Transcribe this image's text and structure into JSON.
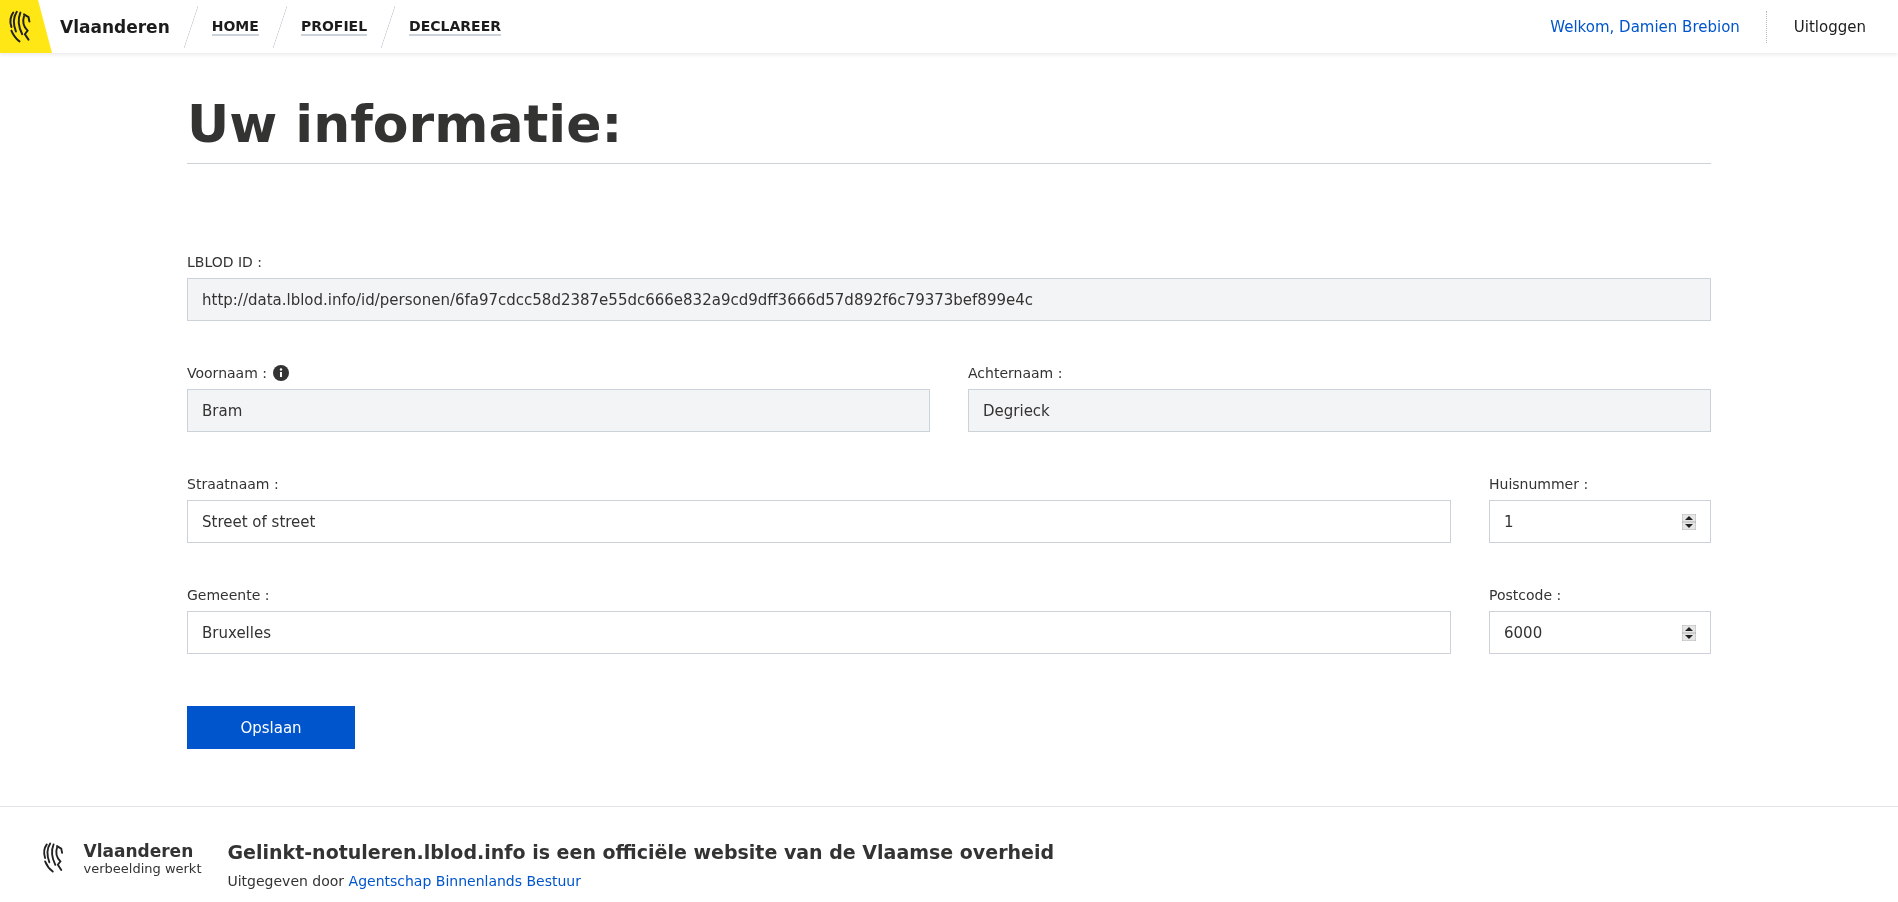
{
  "header": {
    "brand": "Vlaanderen",
    "nav": [
      {
        "label": "HOME"
      },
      {
        "label": "PROFIEL"
      },
      {
        "label": "DECLAREER"
      }
    ],
    "welcome": "Welkom, Damien Brebion",
    "logout": "Uitloggen"
  },
  "page": {
    "title": "Uw informatie:"
  },
  "form": {
    "rows": [
      {
        "fields": [
          {
            "label": "LBLOD ID :",
            "value": "http://data.lblod.info/id/personen/6fa97cdcc58d2387e55dc666e832a9cd9dff3666d57d892f6c79373bef899e4c",
            "kind": "text",
            "readonly": true
          }
        ]
      },
      {
        "fields": [
          {
            "label": "Voornaam :",
            "value": "Bram",
            "kind": "text",
            "readonly": true,
            "info": true
          },
          {
            "label": "Achternaam :",
            "value": "Degrieck",
            "kind": "text",
            "readonly": true
          }
        ]
      },
      {
        "fields": [
          {
            "label": "Straatnaam :",
            "value": "Street of street",
            "kind": "text",
            "readonly": false
          },
          {
            "label": "Huisnummer :",
            "value": "1",
            "kind": "number",
            "readonly": false
          }
        ]
      },
      {
        "fields": [
          {
            "label": "Gemeente :",
            "value": "Bruxelles",
            "kind": "text",
            "readonly": false
          },
          {
            "label": "Postcode :",
            "value": "6000",
            "kind": "number",
            "readonly": false
          }
        ]
      }
    ],
    "submit": "Opslaan"
  },
  "footer": {
    "brand": "Vlaanderen",
    "tagline": "verbeelding werkt",
    "title": "Gelinkt-notuleren.lblod.info is een officiële website van de Vlaamse overheid",
    "publisher_prefix": "Uitgegeven door",
    "publisher_link": "Agentschap Binnenlands Bestuur"
  }
}
